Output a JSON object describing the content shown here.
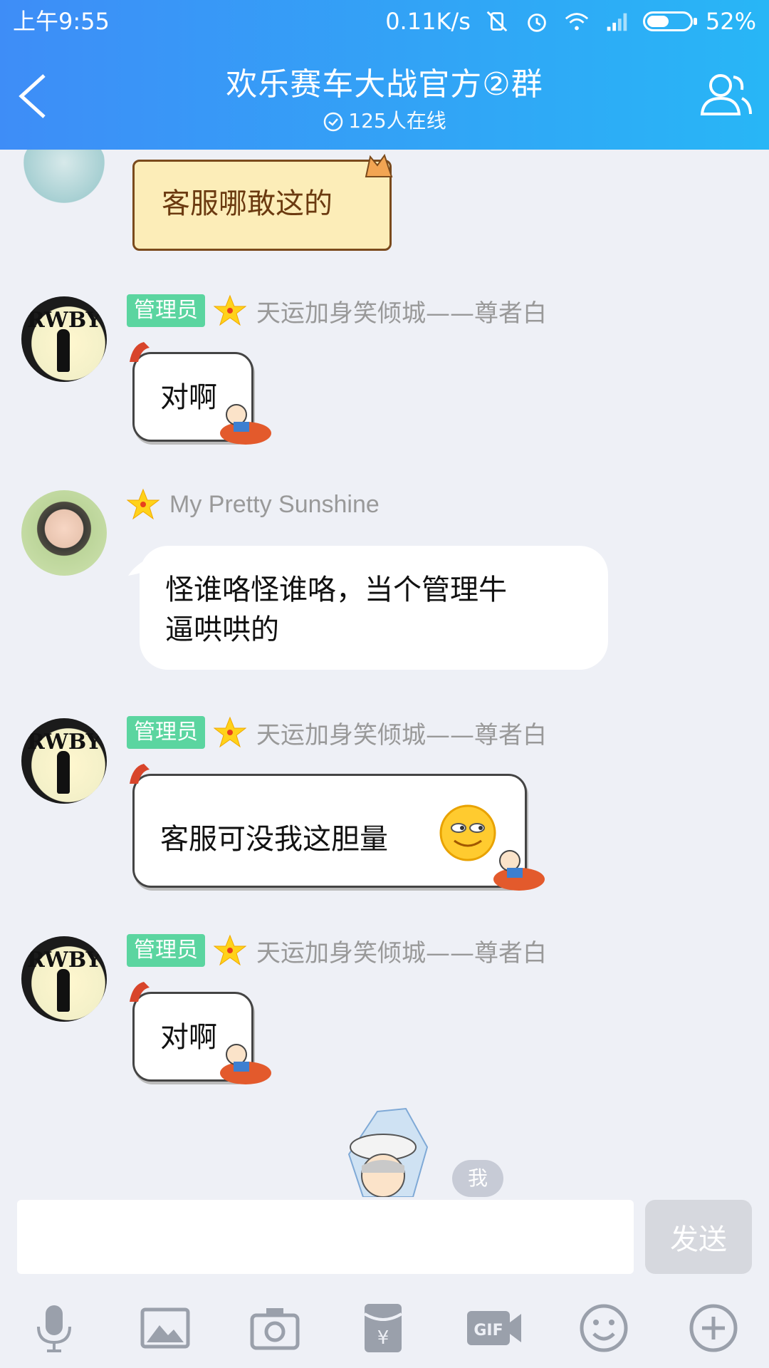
{
  "status_bar": {
    "time": "上午9:55",
    "network_speed": "0.11K/s",
    "battery": "52%",
    "battery_level": 0.52
  },
  "header": {
    "title": "欢乐赛车大战官方②群",
    "online": "125人在线"
  },
  "messages": [
    {
      "text": "客服哪敢这的"
    },
    {
      "badge": "管理员",
      "nick": "天运加身笑倾城——尊者白",
      "text": "对啊"
    },
    {
      "nick": "My Pretty Sunshine",
      "line1": "怪谁咯怪谁咯，当个管理牛",
      "line2": "逼哄哄的"
    },
    {
      "badge": "管理员",
      "nick": "天运加身笑倾城——尊者白",
      "text": "客服可没我这胆量"
    },
    {
      "badge": "管理员",
      "nick": "天运加身笑倾城——尊者白",
      "text": "对啊"
    }
  ],
  "me_tag": "我",
  "input": {
    "placeholder": "",
    "send_label": "发送"
  },
  "toolbar": [
    "microphone-icon",
    "image-icon",
    "camera-icon",
    "red-packet-icon",
    "gif-icon",
    "emoji-icon",
    "plus-icon"
  ],
  "colors": {
    "header_start": "#3e8df7",
    "header_end": "#28b6f6",
    "admin_badge": "#5bd5a0",
    "background": "#eef0f6"
  }
}
